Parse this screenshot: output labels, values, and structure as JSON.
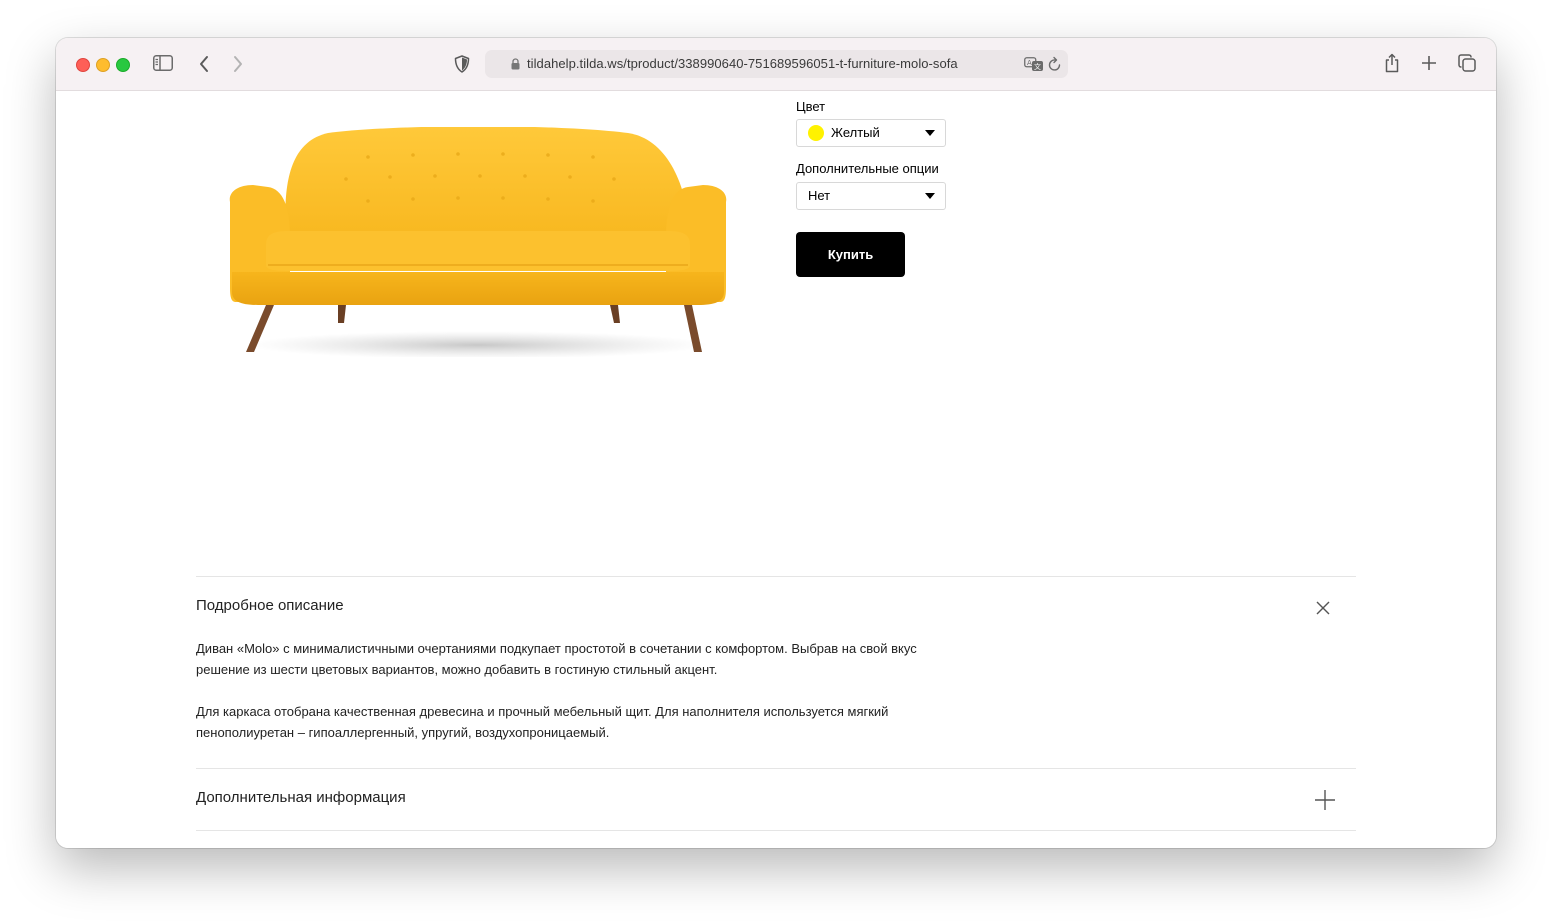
{
  "browser": {
    "url": "tildahelp.tilda.ws/tproduct/338990640-751689596051-t-furniture-molo-sofa"
  },
  "product": {
    "image_alt": "sofa-image",
    "options": [
      {
        "label": "Цвет",
        "value": "Желтый",
        "swatch_color": "#fff200"
      },
      {
        "label": "Дополнительные опции",
        "value": "Нет"
      }
    ],
    "buy_label": "Купить",
    "accent_color": "#000000"
  },
  "accordion": {
    "description": {
      "title": "Подробное описание",
      "paragraphs": [
        "Диван «Molo» с минималистичными очертаниями подкупает простотой в сочетании с комфортом. Выбрав на свой вкус решение из шести цветовых вариантов, можно добавить в гостиную стильный акцент.",
        "Для каркаса отобрана качественная древесина и прочный мебельный щит. Для наполнителя используется мягкий пенополиуретан – гипоаллергенный, упругий, воздухопроницаемый."
      ],
      "icon": "close-icon"
    },
    "extra": {
      "title": "Дополнительная информация",
      "icon": "plus-icon"
    }
  }
}
